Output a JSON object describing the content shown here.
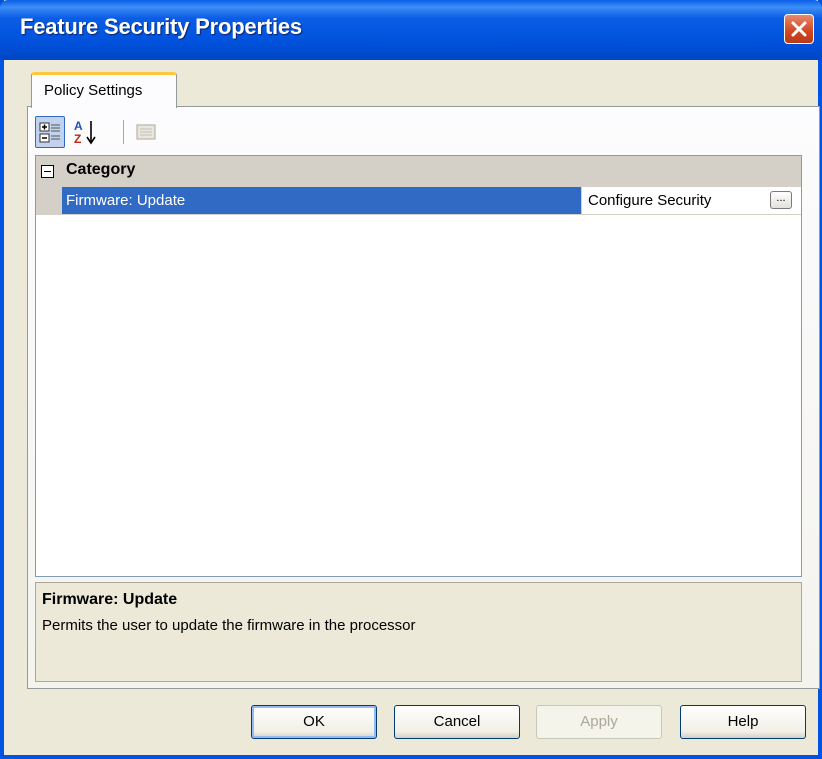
{
  "window": {
    "title": "Feature Security Properties"
  },
  "tabs": [
    {
      "label": "Policy Settings",
      "active": true
    }
  ],
  "toolbar": {
    "buttons": [
      {
        "icon": "categorized-icon",
        "pressed": true
      },
      {
        "icon": "sort-alphabetical-icon",
        "pressed": false
      },
      {
        "icon": "property-pages-icon",
        "enabled": false
      }
    ]
  },
  "grid": {
    "category": "Category",
    "properties": [
      {
        "name": "Firmware: Update",
        "value": "Configure Security",
        "button": "..."
      }
    ]
  },
  "help": {
    "title": "Firmware: Update",
    "description": "Permits the user to update the firmware in the processor"
  },
  "buttons": {
    "ok": "OK",
    "cancel": "Cancel",
    "apply": "Apply",
    "help": "Help"
  },
  "colors": {
    "titlebar": "#0054e3",
    "selection": "#316ac5",
    "tab_accent": "#ffc83c",
    "close": "#d1461f"
  }
}
